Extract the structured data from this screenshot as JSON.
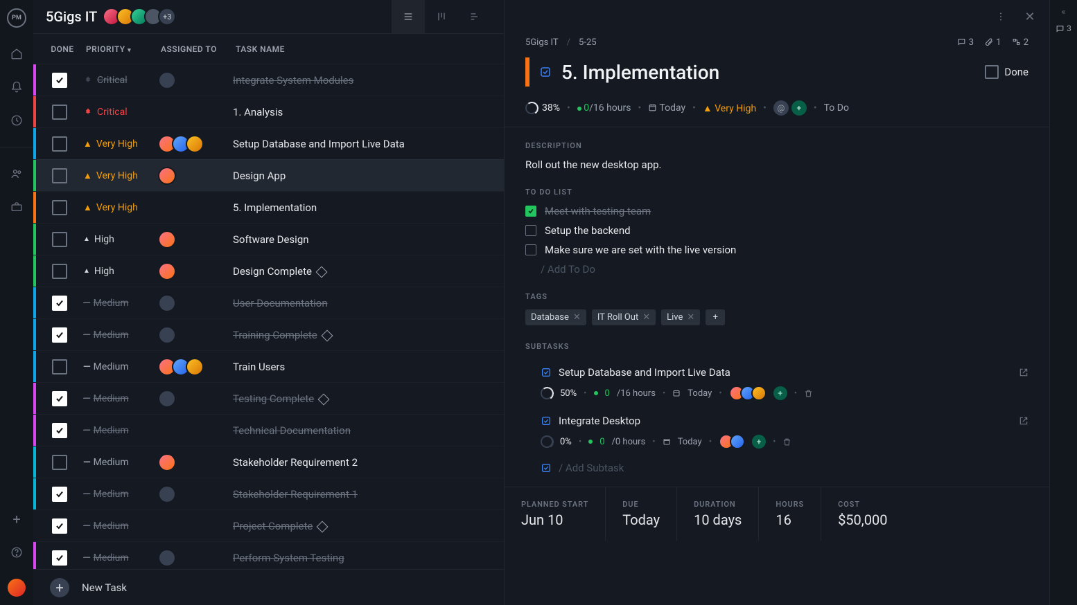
{
  "project": {
    "name": "5Gigs IT",
    "extra_members": "+3"
  },
  "columns": {
    "done": "DONE",
    "priority": "PRIORITY",
    "assigned": "ASSIGNED TO",
    "task": "TASK NAME"
  },
  "priority_labels": {
    "critical": "Critical",
    "very_high": "Very High",
    "high": "High",
    "medium": "Medium"
  },
  "bar_colors": {
    "magenta": "#d946ef",
    "red": "#ef4444",
    "blue": "#0ea5e9",
    "green": "#22c55e",
    "orange": "#f97316",
    "cyan": "#06b6d4"
  },
  "tasks": [
    {
      "done": true,
      "priority": "critical",
      "prio_done": true,
      "bar": "magenta",
      "name": "Integrate System Modules",
      "assignees": [
        "g"
      ]
    },
    {
      "done": false,
      "priority": "critical",
      "bar": "red",
      "name": "1. Analysis",
      "assignees": []
    },
    {
      "done": false,
      "priority": "very_high",
      "bar": "blue",
      "name": "Setup Database and Import Live Data",
      "assignees": [
        "1",
        "2",
        "3"
      ]
    },
    {
      "done": false,
      "priority": "very_high",
      "bar": "green",
      "name": "Design App",
      "assignees": [
        "1"
      ],
      "selected": true
    },
    {
      "done": false,
      "priority": "very_high",
      "bar": "orange",
      "name": "5. Implementation",
      "assignees": []
    },
    {
      "done": false,
      "priority": "high",
      "bar": "green",
      "name": "Software Design",
      "assignees": [
        "1"
      ]
    },
    {
      "done": false,
      "priority": "high",
      "bar": "green",
      "name": "Design Complete",
      "assignees": [
        "1"
      ],
      "milestone": true
    },
    {
      "done": true,
      "priority": "medium",
      "bar": "blue",
      "name": "User Documentation",
      "assignees": [
        "g"
      ]
    },
    {
      "done": true,
      "priority": "medium",
      "bar": "blue",
      "name": "Training Complete",
      "assignees": [
        "g"
      ],
      "milestone": true
    },
    {
      "done": false,
      "priority": "medium",
      "bar": "blue",
      "name": "Train Users",
      "assignees": [
        "1",
        "2",
        "3"
      ]
    },
    {
      "done": true,
      "priority": "medium",
      "bar": "magenta",
      "name": "Testing Complete",
      "assignees": [
        "g"
      ],
      "milestone": true
    },
    {
      "done": true,
      "priority": "medium",
      "bar": "magenta",
      "name": "Technical Documentation",
      "assignees": []
    },
    {
      "done": false,
      "priority": "medium",
      "bar": "cyan",
      "name": "Stakeholder Requirement 2",
      "assignees": [
        "1"
      ]
    },
    {
      "done": true,
      "priority": "medium",
      "bar": "cyan",
      "name": "Stakeholder Requirement 1",
      "assignees": [
        "g"
      ]
    },
    {
      "done": true,
      "priority": "medium",
      "bar": "",
      "name": "Project Complete",
      "assignees": [],
      "milestone": true
    },
    {
      "done": true,
      "priority": "medium",
      "bar": "magenta",
      "name": "Perform System Testing",
      "assignees": [
        "g"
      ]
    }
  ],
  "new_task_label": "New Task",
  "breadcrumb": {
    "project": "5Gigs IT",
    "id": "5-25"
  },
  "counters": {
    "comments": "3",
    "attachments": "1",
    "subtasks": "2",
    "far_comments": "3"
  },
  "detail": {
    "title": "5. Implementation",
    "done_label": "Done",
    "progress": "38%",
    "hours_done": "0",
    "hours_total": "/16 hours",
    "date": "Today",
    "priority": "Very High",
    "status": "To Do",
    "description_h": "DESCRIPTION",
    "description": "Roll out the new desktop app.",
    "todo_h": "TO DO LIST",
    "todos": [
      {
        "done": true,
        "text": "Meet with testing team"
      },
      {
        "done": false,
        "text": "Setup the backend"
      },
      {
        "done": false,
        "text": "Make sure we are set with the live version"
      }
    ],
    "todo_placeholder": "/ Add To Do",
    "tags_h": "TAGS",
    "tags": [
      "Database",
      "IT Roll Out",
      "Live"
    ],
    "subtasks_h": "SUBTASKS",
    "subtasks": [
      {
        "name": "Setup Database and Import Live Data",
        "progress": "50%",
        "hours_done": "0",
        "hours_total": "/16 hours",
        "date": "Today",
        "assignees": [
          "1",
          "2",
          "3"
        ]
      },
      {
        "name": "Integrate Desktop",
        "progress": "0%",
        "p0": true,
        "hours_done": "0",
        "hours_total": "/0 hours",
        "date": "Today",
        "assignees": [
          "1",
          "2"
        ]
      }
    ],
    "subtask_placeholder": "/ Add Subtask",
    "planned": [
      {
        "l": "PLANNED START",
        "v": "Jun 10"
      },
      {
        "l": "DUE",
        "v": "Today"
      },
      {
        "l": "DURATION",
        "v": "10 days"
      },
      {
        "l": "HOURS",
        "v": "16"
      },
      {
        "l": "COST",
        "v": "$50,000"
      }
    ]
  }
}
